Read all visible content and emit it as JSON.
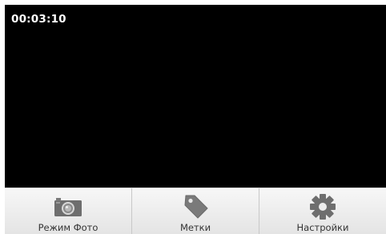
{
  "recording": {
    "elapsed_time": "00:03:10"
  },
  "toolbar": {
    "items": [
      {
        "label": "Режим Фото",
        "icon": "camera-icon"
      },
      {
        "label": "Метки",
        "icon": "tag-icon"
      },
      {
        "label": "Настройки",
        "icon": "gear-icon"
      }
    ]
  },
  "colors": {
    "viewfinder": "#000000",
    "toolbar": "#ececec",
    "icon": "#6e6e6e",
    "timer_text": "#ffffff"
  }
}
